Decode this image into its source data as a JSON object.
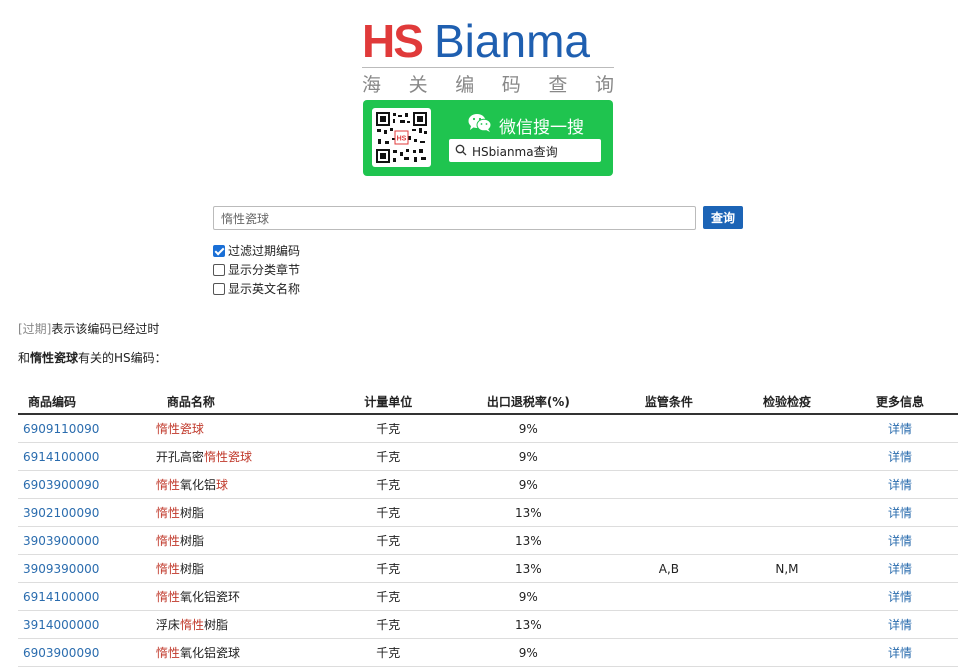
{
  "logo": {
    "hs": "HS",
    "bianma": "Bianma",
    "slogan": [
      "海",
      "关",
      "编",
      "码",
      "查",
      "询"
    ]
  },
  "wechat": {
    "title": "微信搜一搜",
    "search_text": "HSbianma查询",
    "qr_badge": "HS"
  },
  "search": {
    "value": "惰性瓷球",
    "button": "查询"
  },
  "options": [
    {
      "label": "过滤过期编码",
      "checked": true
    },
    {
      "label": "显示分类章节",
      "checked": false
    },
    {
      "label": "显示英文名称",
      "checked": false
    }
  ],
  "note": {
    "expired_tag": "[过期]",
    "text": "表示该编码已经过时"
  },
  "related": {
    "prefix": "和",
    "keyword": "惰性瓷球",
    "suffix": "有关的HS编码："
  },
  "table": {
    "headers": [
      "商品编码",
      "商品名称",
      "计量单位",
      "出口退税率(%)",
      "监管条件",
      "检验检疫",
      "更多信息"
    ],
    "rows": [
      {
        "code": "6909110090",
        "name": [
          {
            "t": "惰性瓷球",
            "h": true
          }
        ],
        "unit": "千克",
        "rate": "9%",
        "sup": "",
        "ins": "",
        "more": "详情"
      },
      {
        "code": "6914100000",
        "name": [
          {
            "t": "开孔高密",
            "h": false
          },
          {
            "t": "惰性瓷球",
            "h": true
          }
        ],
        "unit": "千克",
        "rate": "9%",
        "sup": "",
        "ins": "",
        "more": "详情"
      },
      {
        "code": "6903900090",
        "name": [
          {
            "t": "惰性",
            "h": true
          },
          {
            "t": "氧化铝",
            "h": false
          },
          {
            "t": "球",
            "h": true
          }
        ],
        "unit": "千克",
        "rate": "9%",
        "sup": "",
        "ins": "",
        "more": "详情"
      },
      {
        "code": "3902100090",
        "name": [
          {
            "t": "惰性",
            "h": true
          },
          {
            "t": "树脂",
            "h": false
          }
        ],
        "unit": "千克",
        "rate": "13%",
        "sup": "",
        "ins": "",
        "more": "详情"
      },
      {
        "code": "3903900000",
        "name": [
          {
            "t": "惰性",
            "h": true
          },
          {
            "t": "树脂",
            "h": false
          }
        ],
        "unit": "千克",
        "rate": "13%",
        "sup": "",
        "ins": "",
        "more": "详情"
      },
      {
        "code": "3909390000",
        "name": [
          {
            "t": "惰性",
            "h": true
          },
          {
            "t": "树脂",
            "h": false
          }
        ],
        "unit": "千克",
        "rate": "13%",
        "sup": "A,B",
        "ins": "N,M",
        "more": "详情"
      },
      {
        "code": "6914100000",
        "name": [
          {
            "t": "惰性",
            "h": true
          },
          {
            "t": "氧化铝瓷环",
            "h": false
          }
        ],
        "unit": "千克",
        "rate": "9%",
        "sup": "",
        "ins": "",
        "more": "详情"
      },
      {
        "code": "3914000000",
        "name": [
          {
            "t": "浮床",
            "h": false
          },
          {
            "t": "惰性",
            "h": true
          },
          {
            "t": "树脂",
            "h": false
          }
        ],
        "unit": "千克",
        "rate": "13%",
        "sup": "",
        "ins": "",
        "more": "详情"
      },
      {
        "code": "6903900090",
        "name": [
          {
            "t": "惰性",
            "h": true
          },
          {
            "t": "氧化铝瓷球",
            "h": false
          }
        ],
        "unit": "千克",
        "rate": "9%",
        "sup": "",
        "ins": "",
        "more": "详情"
      }
    ]
  },
  "colors": {
    "accent": "#1c64b6",
    "wechat": "#1fc44f",
    "highlight": "#c0392b",
    "logo_red": "#e03a3a",
    "logo_blue": "#1f5fb0"
  }
}
